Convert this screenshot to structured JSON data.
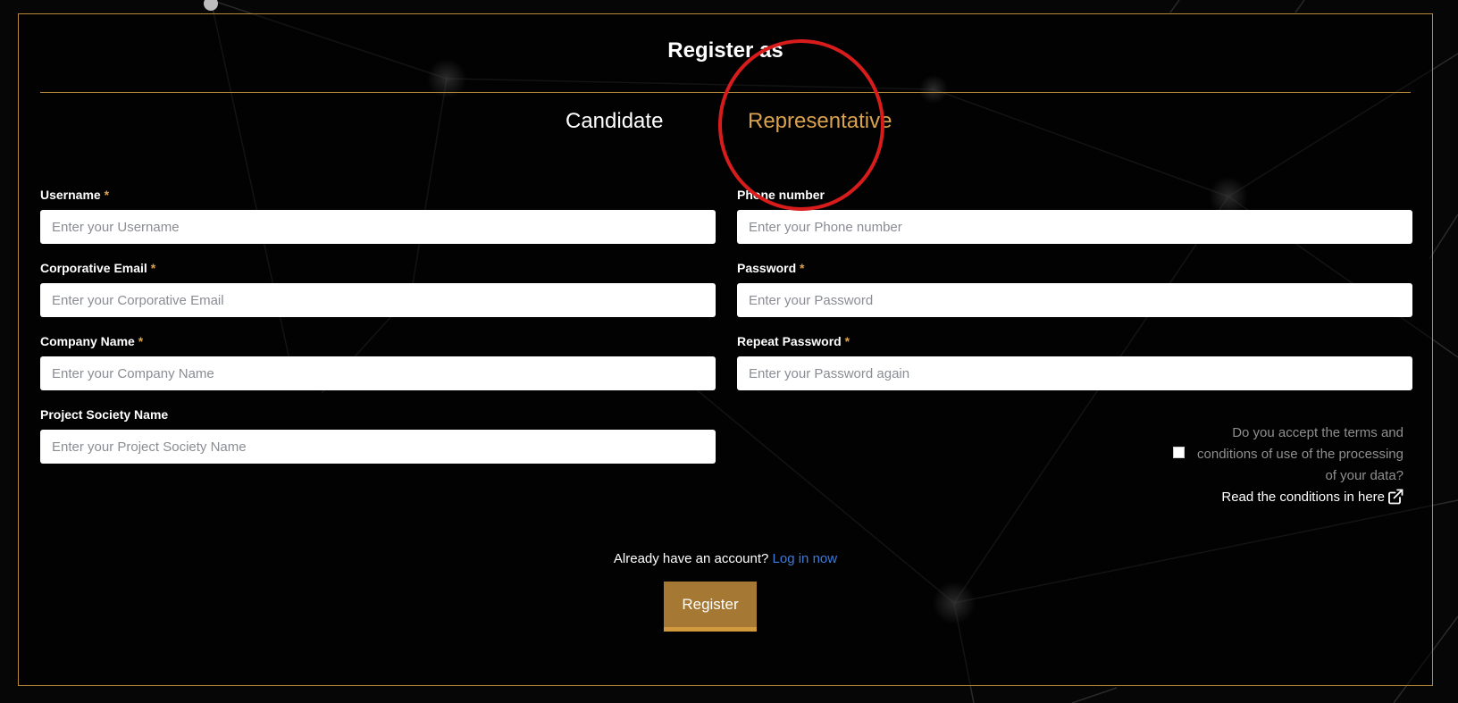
{
  "form": {
    "title": "Register as",
    "tabs": [
      {
        "label": "Candidate",
        "active": false
      },
      {
        "label": "Representative",
        "active": true
      }
    ],
    "required_marker": "*",
    "fields": {
      "username": {
        "label": "Username",
        "placeholder": "Enter your Username",
        "required": true
      },
      "phone": {
        "label": "Phone number",
        "placeholder": "Enter your Phone number",
        "required": false
      },
      "email": {
        "label": "Corporative Email",
        "placeholder": "Enter your Corporative Email",
        "required": true
      },
      "password": {
        "label": "Password",
        "placeholder": "Enter your Password",
        "required": true
      },
      "company": {
        "label": "Company Name",
        "placeholder": "Enter your Company Name",
        "required": true
      },
      "repeat_password": {
        "label": "Repeat Password",
        "placeholder": "Enter your Password again",
        "required": true
      },
      "project_society": {
        "label": "Project Society Name",
        "placeholder": "Enter your Project Society Name",
        "required": false
      }
    },
    "terms": {
      "question": "Do you accept the terms and conditions of use of the processing of your data?",
      "link_label": "Read the conditions in here",
      "link_icon": "external-link-icon",
      "checked": false
    },
    "login_prompt": "Already have an account?",
    "login_link": "Log in now",
    "register_label": "Register"
  },
  "colors": {
    "accent": "#b8893a",
    "active_tab": "#d9a24e",
    "link": "#3d7bdc",
    "button": "#a57833",
    "annotation": "#d81c1c"
  }
}
